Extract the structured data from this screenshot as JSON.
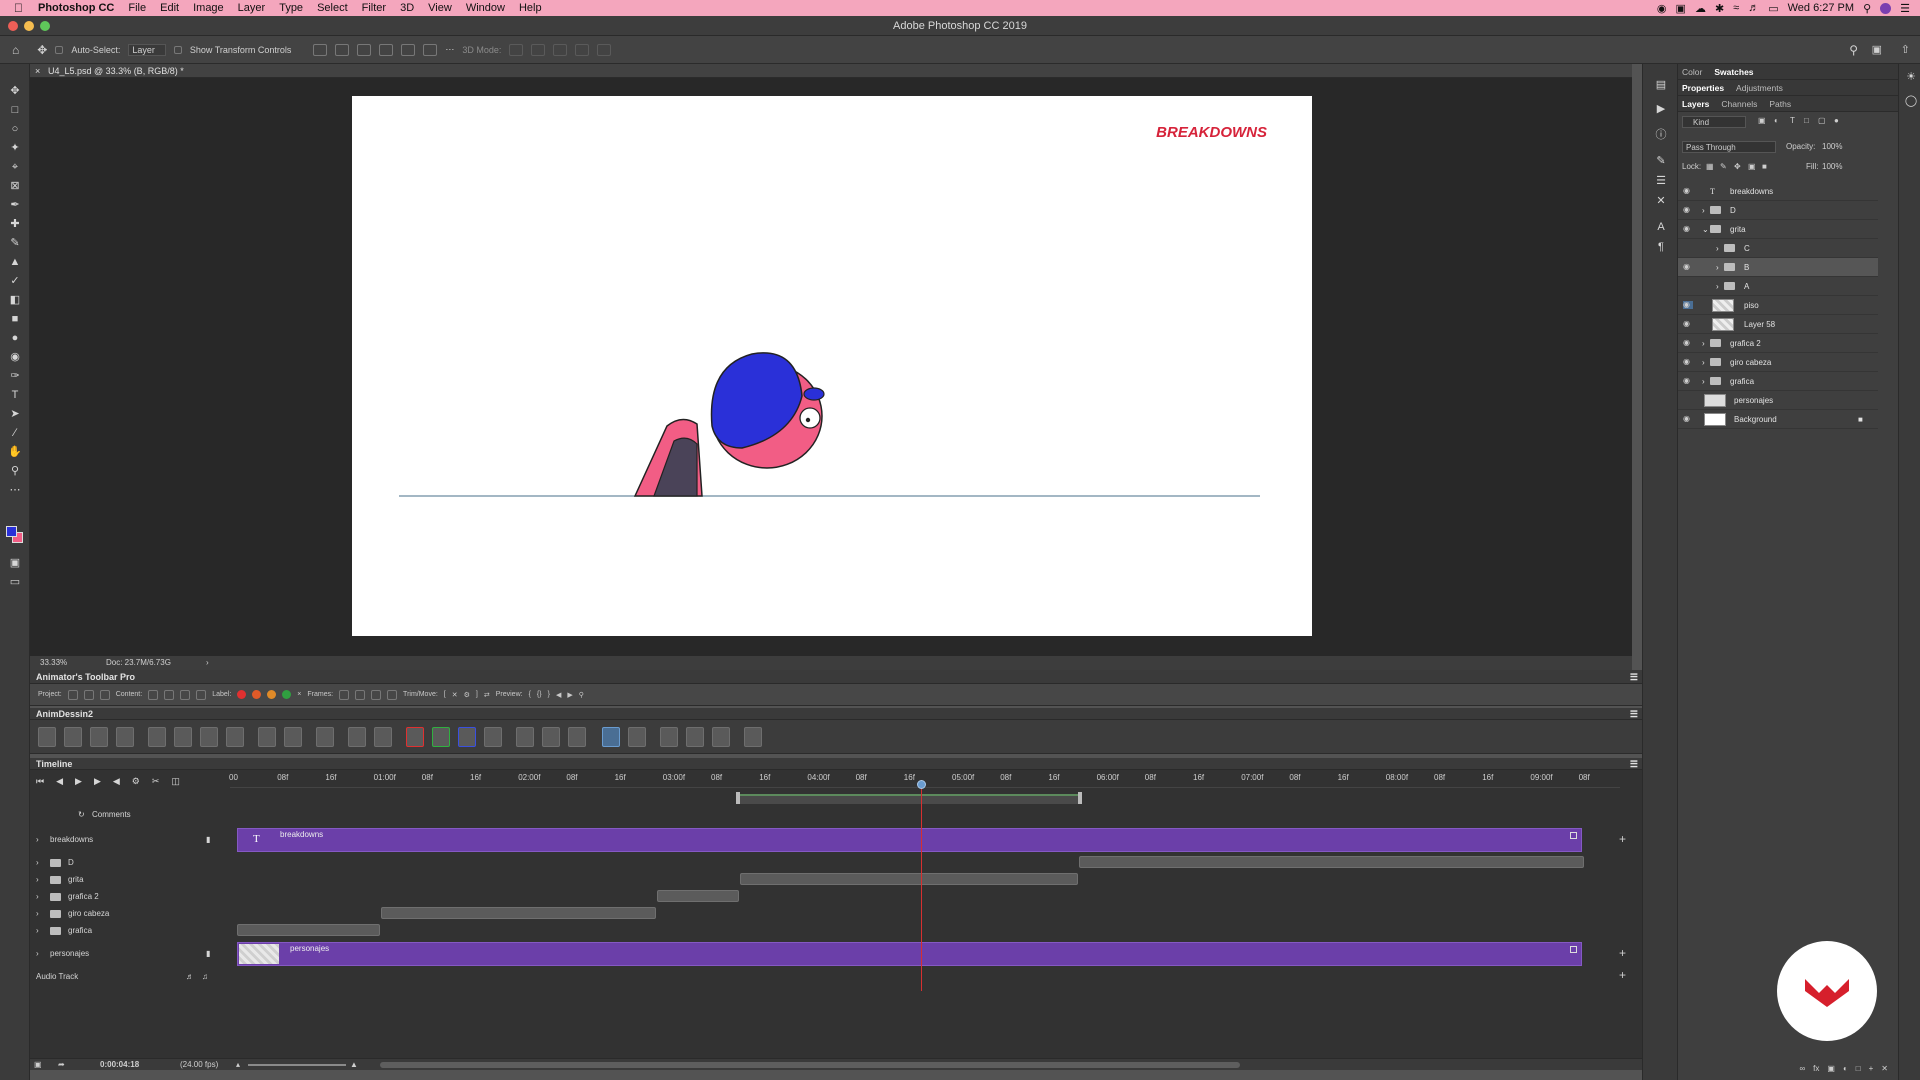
{
  "menubar": {
    "app": "Photoshop CC",
    "items": [
      "File",
      "Edit",
      "Image",
      "Layer",
      "Type",
      "Select",
      "Filter",
      "3D",
      "View",
      "Window",
      "Help"
    ],
    "clock": "Wed 6:27 PM"
  },
  "window": {
    "title": "Adobe Photoshop CC 2019"
  },
  "options": {
    "auto_select_label": "Auto-Select:",
    "auto_select_value": "Layer",
    "show_transform": "Show Transform Controls",
    "mode_3d": "3D Mode:"
  },
  "document": {
    "tab": "U4_L5.psd @ 33.3% (B, RGB/8) *",
    "zoom": "33.33%",
    "doc_size": "Doc: 23.7M/6.73G",
    "artwork_title": "BREAKDOWNS"
  },
  "atp": {
    "title": "Animator's Toolbar Pro",
    "project": "Project:",
    "content": "Content:",
    "label": "Label:",
    "frames": "Frames:",
    "trim_move": "Trim/Move:",
    "preview": "Preview:",
    "label_colors": [
      "#e03030",
      "#e05a28",
      "#e08a28",
      "#30a040"
    ]
  },
  "animdessin": {
    "title": "AnimDessin2"
  },
  "timeline": {
    "title": "Timeline",
    "ruler": [
      "00",
      "08f",
      "16f",
      "01:00f",
      "08f",
      "16f",
      "02:00f",
      "08f",
      "16f",
      "03:00f",
      "08f",
      "16f",
      "04:00f",
      "08f",
      "16f",
      "05:00f",
      "08f",
      "16f",
      "06:00f",
      "08f",
      "16f",
      "07:00f",
      "08f",
      "16f",
      "08:00f",
      "08f",
      "16f",
      "09:00f",
      "08f"
    ],
    "comments": "Comments",
    "layers": [
      {
        "name": "breakdowns",
        "type": "video",
        "clip_label": "breakdowns"
      },
      {
        "name": "D",
        "type": "folder"
      },
      {
        "name": "grita",
        "type": "folder"
      },
      {
        "name": "grafica 2",
        "type": "folder"
      },
      {
        "name": "giro cabeza",
        "type": "folder"
      },
      {
        "name": "grafica",
        "type": "folder"
      },
      {
        "name": "personajes",
        "type": "video",
        "clip_label": "personajes"
      }
    ],
    "audio_track": "Audio Track",
    "current_time": "0:00:04:18",
    "fps": "(24.00 fps)"
  },
  "right_panel": {
    "top_tabs": [
      "Color",
      "Swatches"
    ],
    "prop_tabs": [
      "Properties",
      "Adjustments"
    ],
    "layer_tabs": [
      "Layers",
      "Channels",
      "Paths"
    ],
    "filter_kind": "Kind",
    "blend_mode": "Pass Through",
    "opacity_label": "Opacity:",
    "opacity": "100%",
    "lock_label": "Lock:",
    "fill_label": "Fill:",
    "fill": "100%",
    "layers": [
      {
        "name": "breakdowns",
        "kind": "text",
        "indent": 0,
        "visible": true
      },
      {
        "name": "D",
        "kind": "folder",
        "indent": 0,
        "visible": true
      },
      {
        "name": "grita",
        "kind": "folder-open",
        "indent": 0,
        "visible": true
      },
      {
        "name": "C",
        "kind": "folder",
        "indent": 1,
        "visible": false
      },
      {
        "name": "B",
        "kind": "folder",
        "indent": 1,
        "visible": true,
        "selected": true
      },
      {
        "name": "A",
        "kind": "folder",
        "indent": 1,
        "visible": false
      },
      {
        "name": "piso",
        "kind": "pixel",
        "indent": 1,
        "visible": true
      },
      {
        "name": "Layer 58",
        "kind": "pixel",
        "indent": 1,
        "visible": true
      },
      {
        "name": "grafica 2",
        "kind": "folder",
        "indent": 0,
        "visible": true
      },
      {
        "name": "giro cabeza",
        "kind": "folder",
        "indent": 0,
        "visible": true
      },
      {
        "name": "grafica",
        "kind": "folder",
        "indent": 0,
        "visible": true
      },
      {
        "name": "personajes",
        "kind": "video",
        "indent": 0,
        "visible": false
      },
      {
        "name": "Background",
        "kind": "background",
        "indent": 0,
        "visible": true
      }
    ]
  },
  "colors": {
    "menubar": "#f4a6bd",
    "accent_purple": "#6b3fa9",
    "title_red": "#d6233a",
    "char_pink": "#f25d85",
    "char_blue": "#2a30d8",
    "playhead": "#d63030"
  }
}
